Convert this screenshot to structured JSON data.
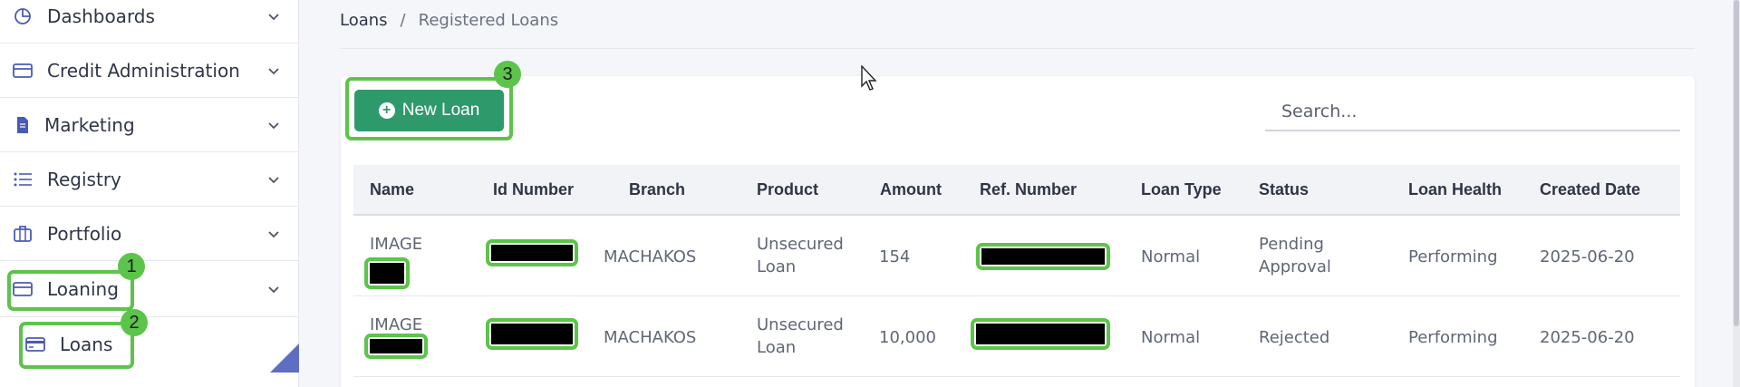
{
  "sidebar": {
    "items": [
      {
        "label": "Dashboards",
        "icon": "pie-chart-icon"
      },
      {
        "label": "Credit Administration",
        "icon": "card-icon"
      },
      {
        "label": "Marketing",
        "icon": "document-icon"
      },
      {
        "label": "Registry",
        "icon": "list-icon"
      },
      {
        "label": "Portfolio",
        "icon": "briefcase-icon"
      },
      {
        "label": "Loaning",
        "icon": "card-icon"
      }
    ],
    "sub_items": [
      {
        "label": "Loans",
        "icon": "credit-card-icon"
      }
    ]
  },
  "markers": [
    "1",
    "2",
    "3"
  ],
  "breadcrumb": {
    "root": "Loans",
    "separator": "/",
    "current": "Registered Loans"
  },
  "toolbar": {
    "new_button_label": "New Loan",
    "search_placeholder": "Search..."
  },
  "table": {
    "columns": [
      "Name",
      "Id Number",
      "Branch",
      "Product",
      "Amount",
      "Ref. Number",
      "Loan Type",
      "Status",
      "Loan Health",
      "Created Date"
    ],
    "rows": [
      {
        "name": "IMAGE",
        "branch": "MACHAKOS",
        "product_line1": "Unsecured",
        "product_line2": "Loan",
        "amount": "154",
        "loan_type": "Normal",
        "status_line1": "Pending",
        "status_line2": "Approval",
        "loan_health": "Performing",
        "created_date": "2025-06-20"
      },
      {
        "name": "IMAGE",
        "branch": "MACHAKOS",
        "product_line1": "Unsecured",
        "product_line2": "Loan",
        "amount": "10,000",
        "loan_type": "Normal",
        "status_line1": "Rejected",
        "status_line2": "",
        "loan_health": "Performing",
        "created_date": "2025-06-20"
      }
    ]
  },
  "colors": {
    "accent_green": "#2e9a6c",
    "highlight": "#5cc44a",
    "sidebar_icon": "#4a5bb4"
  }
}
